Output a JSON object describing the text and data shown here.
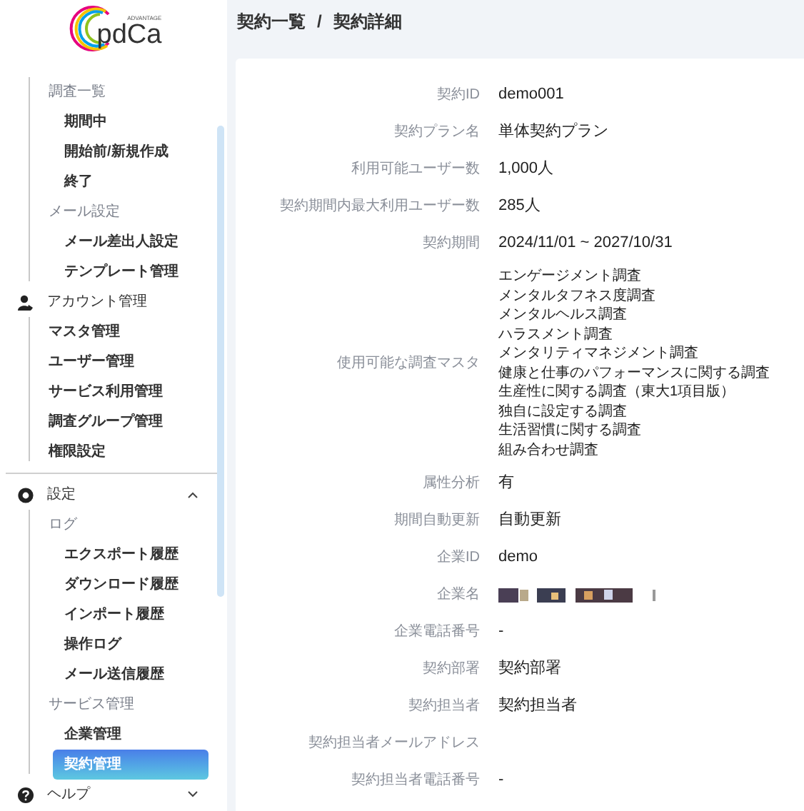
{
  "logo": {
    "tagline": "ADVANTAGE",
    "wordmark": "pdCa"
  },
  "sidebar": {
    "sections": [
      {
        "children": [
          {
            "label": "調査一覧",
            "selected": false,
            "children": [
              {
                "label": "期間中",
                "selected": false
              },
              {
                "label": "開始前/新規作成",
                "selected": false
              },
              {
                "label": "終了",
                "selected": false
              }
            ]
          },
          {
            "label": "メール設定",
            "selected": false,
            "children": [
              {
                "label": "メール差出人設定",
                "selected": false
              },
              {
                "label": "テンプレート管理",
                "selected": false
              }
            ]
          }
        ]
      },
      {
        "label": "アカウント管理",
        "children": [
          {
            "label": "マスタ管理",
            "selected": false
          },
          {
            "label": "ユーザー管理",
            "selected": false
          },
          {
            "label": "サービス利用管理",
            "selected": false
          },
          {
            "label": "調査グループ管理",
            "selected": false
          },
          {
            "label": "権限設定",
            "selected": false
          }
        ]
      },
      {
        "label": "設定",
        "expanded": true,
        "children": [
          {
            "label": "ログ",
            "selected": false,
            "children": [
              {
                "label": "エクスポート履歴",
                "selected": false
              },
              {
                "label": "ダウンロード履歴",
                "selected": false
              },
              {
                "label": "インポート履歴",
                "selected": false
              },
              {
                "label": "操作ログ",
                "selected": false
              },
              {
                "label": "メール送信履歴",
                "selected": false
              }
            ]
          },
          {
            "label": "サービス管理",
            "selected": false,
            "children": [
              {
                "label": "企業管理",
                "selected": false
              },
              {
                "label": "契約管理",
                "selected": true
              }
            ]
          }
        ]
      },
      {
        "label": "ヘルプ",
        "expanded": false
      }
    ]
  },
  "breadcrumb": [
    "契約一覧",
    "/",
    "契約詳細"
  ],
  "details": [
    {
      "kind": "text",
      "label": "契約ID",
      "value": "demo001"
    },
    {
      "kind": "text",
      "label": "契約プラン名",
      "value": "単体契約プラン"
    },
    {
      "kind": "text",
      "label": "利用可能ユーザー数",
      "value": "1,000人"
    },
    {
      "kind": "text",
      "label": "契約期間内最大利用ユーザー数",
      "value": "285人"
    },
    {
      "kind": "text",
      "label": "契約期間",
      "value": "2024/11/01 ~ 2027/10/31"
    },
    {
      "kind": "list",
      "label": "使用可能な調査マスタ",
      "values": [
        "エンゲージメント調査",
        "メンタルタフネス度調査",
        "メンタルヘルス調査",
        "ハラスメント調査",
        "メンタリティマネジメント調査",
        "健康と仕事のパフォーマンスに関する調査",
        "生産性に関する調査（東大1項目版）",
        "独自に設定する調査",
        "生活習慣に関する調査",
        "組み合わせ調査"
      ]
    },
    {
      "kind": "text",
      "label": "属性分析",
      "value": "有"
    },
    {
      "kind": "text",
      "label": "期間自動更新",
      "value": "自動更新"
    },
    {
      "kind": "text",
      "label": "企業ID",
      "value": "demo"
    },
    {
      "kind": "redacted",
      "label": "企業名"
    },
    {
      "kind": "text",
      "label": "企業電話番号",
      "value": "-"
    },
    {
      "kind": "text",
      "label": "契約部署",
      "value": "契約部署"
    },
    {
      "kind": "text",
      "label": "契約担当者",
      "value": "契約担当者"
    },
    {
      "kind": "empty",
      "label": "契約担当者メールアドレス"
    },
    {
      "kind": "text",
      "label": "契約担当者電話番号",
      "value": "-"
    }
  ]
}
